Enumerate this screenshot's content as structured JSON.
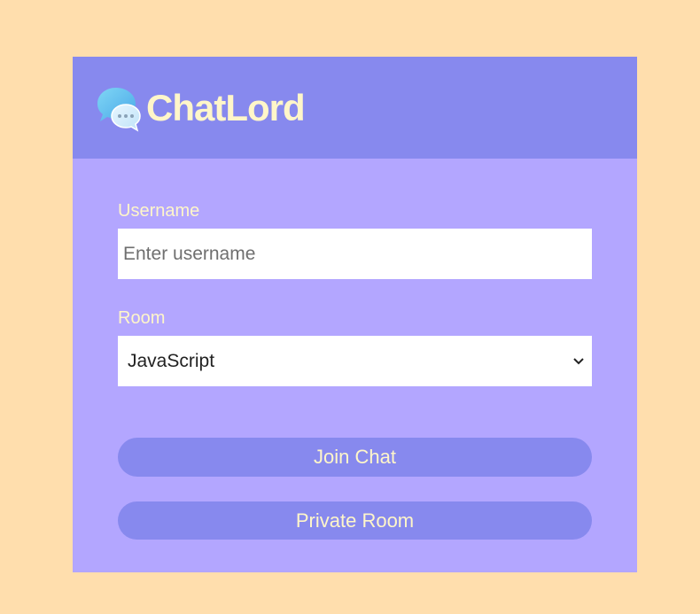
{
  "header": {
    "brand": "ChatLord",
    "logo_icon": "chat-bubbles-icon"
  },
  "form": {
    "username": {
      "label": "Username",
      "placeholder": "Enter username",
      "value": ""
    },
    "room": {
      "label": "Room",
      "selected": "JavaScript"
    },
    "join_label": "Join Chat",
    "private_label": "Private Room"
  },
  "colors": {
    "page_background": "#FFDEAD",
    "card_body": "#B3A6FF",
    "card_header": "#8789EE",
    "accent_text": "#FFF6C9",
    "button": "#8789EE"
  }
}
